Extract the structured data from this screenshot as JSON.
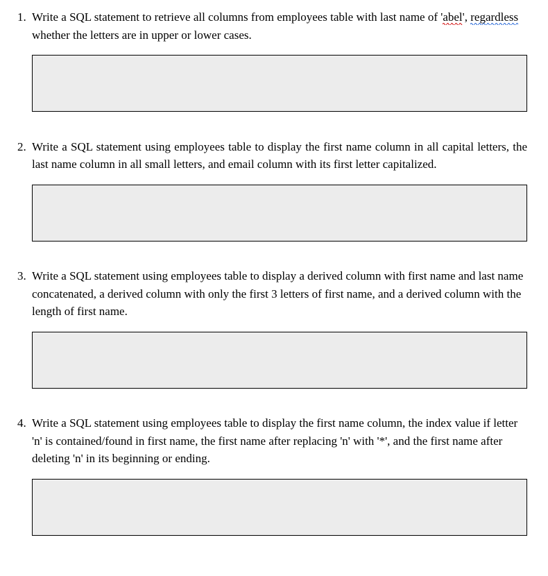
{
  "questions": [
    {
      "number": "1.",
      "prompt_pre": "Write a SQL statement to retrieve all columns from employees table with last name of '",
      "spell_word": "abel",
      "prompt_mid": "', ",
      "grammar_word": "regardless",
      "prompt_post": " whether the letters are in upper or lower cases.",
      "answer": ""
    },
    {
      "number": "2.",
      "prompt": "Write a SQL statement using employees table to display the first name column in all capital letters, the last name column in all small letters, and email column with its first letter capitalized.",
      "answer": ""
    },
    {
      "number": "3.",
      "prompt": "Write a SQL statement using employees table to display a derived column with first name and last name concatenated, a derived column with only the first 3 letters of first name, and a derived column with the length of first name.",
      "answer": ""
    },
    {
      "number": "4.",
      "prompt": "Write a SQL statement using employees table to display the first name column, the index value if letter 'n' is contained/found in first name, the first name after replacing 'n' with '*', and the first name after deleting 'n' in its beginning or ending.",
      "answer": ""
    }
  ]
}
